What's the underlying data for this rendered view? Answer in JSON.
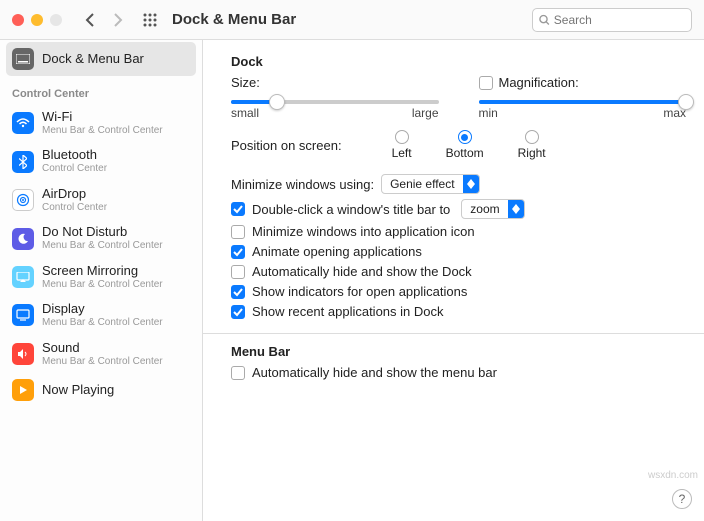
{
  "toolbar": {
    "title": "Dock & Menu Bar",
    "search_placeholder": "Search"
  },
  "sidebar": {
    "top_item": {
      "label": "Dock & Menu Bar"
    },
    "section_label": "Control Center",
    "items": [
      {
        "label": "Wi-Fi",
        "sub": "Menu Bar & Control Center"
      },
      {
        "label": "Bluetooth",
        "sub": "Control Center"
      },
      {
        "label": "AirDrop",
        "sub": "Control Center"
      },
      {
        "label": "Do Not Disturb",
        "sub": "Menu Bar & Control Center"
      },
      {
        "label": "Screen Mirroring",
        "sub": "Menu Bar & Control Center"
      },
      {
        "label": "Display",
        "sub": "Menu Bar & Control Center"
      },
      {
        "label": "Sound",
        "sub": "Menu Bar & Control Center"
      },
      {
        "label": "Now Playing",
        "sub": ""
      }
    ]
  },
  "dock": {
    "heading": "Dock",
    "size_label": "Size:",
    "size_small": "small",
    "size_large": "large",
    "size_value_pct": 22,
    "mag_label": "Magnification:",
    "mag_min": "min",
    "mag_max": "max",
    "mag_value_pct": 100,
    "mag_checked": false,
    "position_label": "Position on screen:",
    "positions": {
      "left": "Left",
      "bottom": "Bottom",
      "right": "Right"
    },
    "position_selected": "bottom",
    "minimize_label": "Minimize windows using:",
    "minimize_value": "Genie effect",
    "cb_doubleclick": {
      "label_a": "Double-click a window's title bar to",
      "value": "zoom",
      "checked": true
    },
    "cb_min_into_icon": {
      "label": "Minimize windows into application icon",
      "checked": false
    },
    "cb_animate": {
      "label": "Animate opening applications",
      "checked": true
    },
    "cb_autohide_dock": {
      "label": "Automatically hide and show the Dock",
      "checked": false
    },
    "cb_indicators": {
      "label": "Show indicators for open applications",
      "checked": true
    },
    "cb_recent": {
      "label": "Show recent applications in Dock",
      "checked": true
    }
  },
  "menubar": {
    "heading": "Menu Bar",
    "cb_autohide": {
      "label": "Automatically hide and show the menu bar",
      "checked": false
    }
  },
  "help_glyph": "?",
  "watermark": "wsxdn.com"
}
